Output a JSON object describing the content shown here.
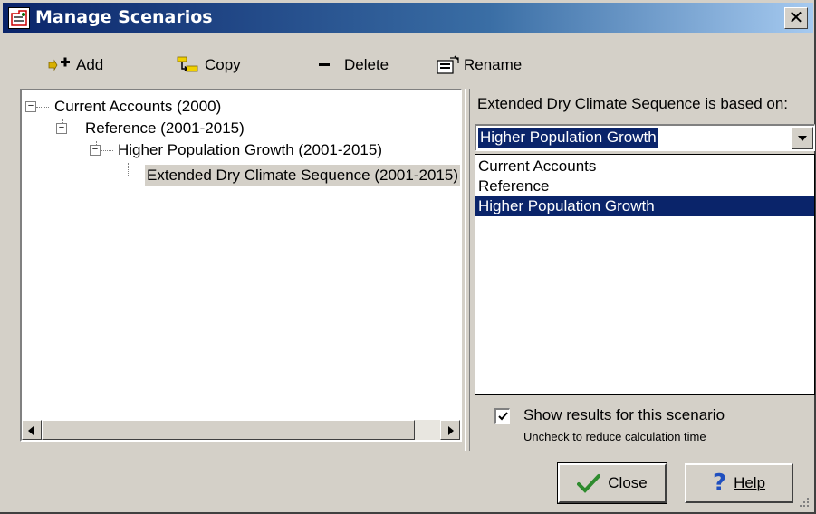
{
  "window": {
    "title": "Manage Scenarios",
    "close_glyph": "✕"
  },
  "toolbar": {
    "add_label": "Add",
    "copy_label": "Copy",
    "delete_label": "Delete",
    "rename_label": "Rename"
  },
  "tree": {
    "items": [
      {
        "label": "Current Accounts (2000)"
      },
      {
        "label": "Reference (2001-2015)"
      },
      {
        "label": "Higher Population Growth (2001-2015)"
      },
      {
        "label": "Extended Dry Climate Sequence (2001-2015)"
      }
    ]
  },
  "based_on": {
    "label": "Extended Dry Climate Sequence is based on:",
    "selected_value": "Higher Population Growth",
    "options": [
      "Current Accounts",
      "Reference",
      "Higher Population Growth"
    ]
  },
  "show_results": {
    "checked": true,
    "label": "Show results for this scenario",
    "sublabel": "Uncheck to reduce calculation time"
  },
  "buttons": {
    "close_label": "Close",
    "help_label": "Help"
  },
  "colors": {
    "title_bar": "#0a246a",
    "selection": "#0a246a",
    "face": "#d4d0c8",
    "check_green": "#2e8b2e",
    "help_blue": "#1f4fbf"
  },
  "icons": {
    "title": "scenario-icon",
    "add": "add-plus-icon",
    "copy": "copy-icon",
    "delete": "delete-minus-icon",
    "rename": "rename-icon",
    "close_check": "checkmark-icon",
    "help": "question-mark-icon"
  }
}
